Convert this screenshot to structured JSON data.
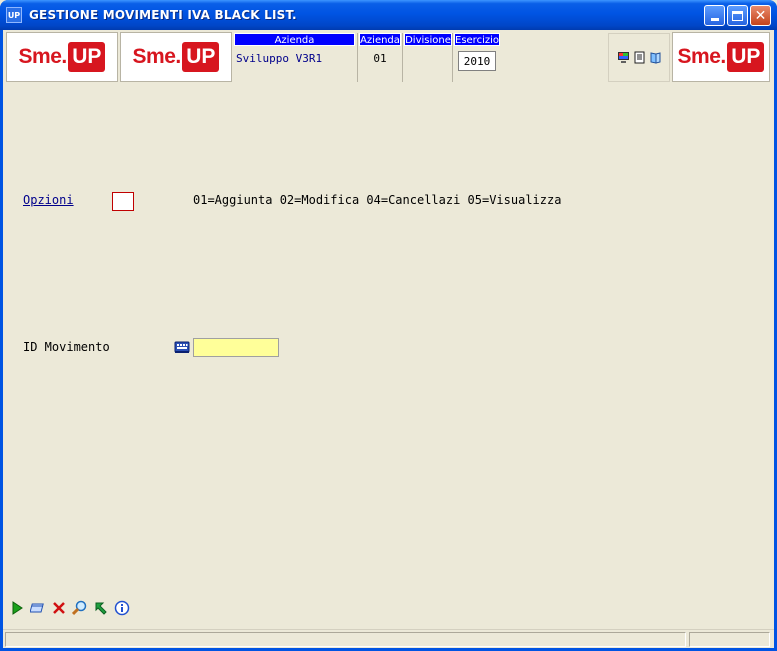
{
  "window": {
    "app_icon_text": "UP",
    "title": "GESTIONE MOVIMENTI IVA BLACK LIST."
  },
  "header": {
    "logo": {
      "brand": "Sme",
      "dot": ".",
      "badge": "UP"
    },
    "azienda_name": {
      "label": "Azienda",
      "value": "Sviluppo V3R1"
    },
    "azienda_code": {
      "label": "Azienda",
      "value": "01"
    },
    "divisione": {
      "label": "Divisione",
      "value": ""
    },
    "esercizio": {
      "label": "Esercizio",
      "value": "2010"
    }
  },
  "form": {
    "opzioni": {
      "label": "Opzioni",
      "value": "",
      "help": "01=Aggiunta 02=Modifica 04=Cancellazi 05=Visualizza"
    },
    "id_movimento": {
      "label": "ID Movimento",
      "value": ""
    }
  },
  "bottom_toolbar": {
    "icons": [
      "run-icon",
      "window-icon",
      "cancel-icon",
      "search-icon",
      "back-arrow-icon",
      "info-icon"
    ]
  },
  "colors": {
    "titlebar": "#0054e3",
    "header_label_bg": "#0000ff",
    "brand_red": "#d7161f",
    "field_highlight": "#ffff99",
    "window_bg": "#ece9d8"
  }
}
